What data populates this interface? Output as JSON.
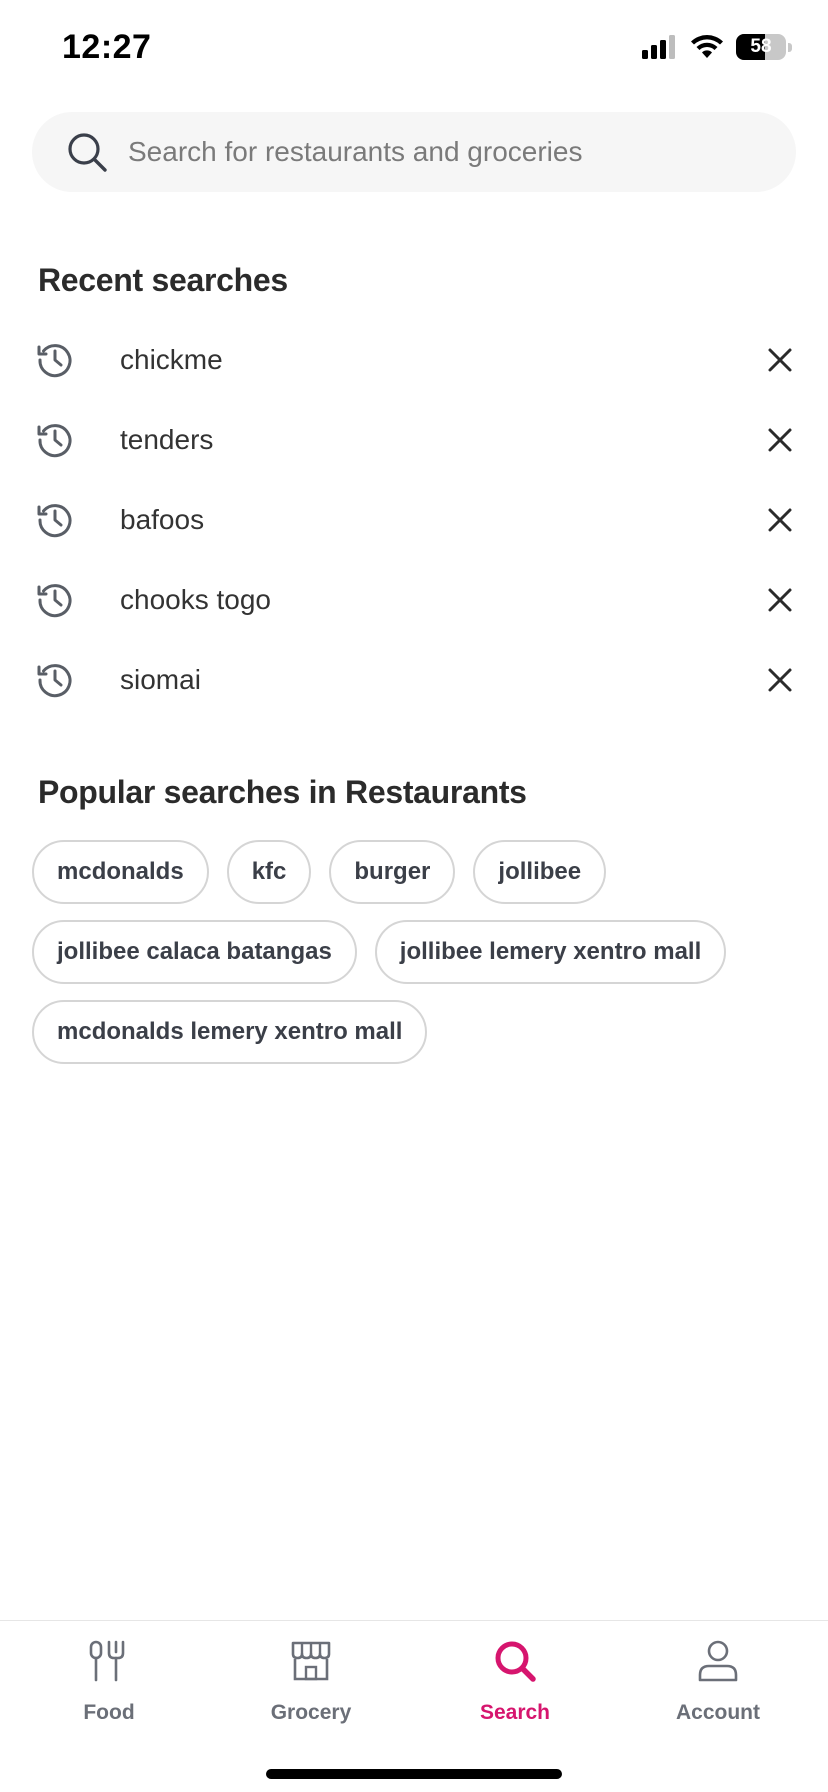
{
  "status_bar": {
    "time": "12:27",
    "battery_level": "58",
    "icons": [
      "signal-icon",
      "wifi-icon",
      "battery-icon"
    ]
  },
  "search": {
    "placeholder": "Search for restaurants and groceries",
    "value": "",
    "icon": "search-icon"
  },
  "recent": {
    "title": "Recent searches",
    "items": [
      {
        "label": "chickme"
      },
      {
        "label": "tenders"
      },
      {
        "label": "bafoos"
      },
      {
        "label": "chooks togo"
      },
      {
        "label": "siomai"
      }
    ]
  },
  "popular": {
    "title": "Popular searches in Restaurants",
    "chips": [
      "mcdonalds",
      "kfc",
      "burger",
      "jollibee",
      "jollibee calaca batangas",
      "jollibee lemery xentro mall",
      "mcdonalds lemery xentro mall"
    ]
  },
  "nav": {
    "items": [
      {
        "label": "Food",
        "icon": "fork-knife-icon",
        "active": false
      },
      {
        "label": "Grocery",
        "icon": "store-icon",
        "active": false
      },
      {
        "label": "Search",
        "icon": "search-icon",
        "active": true
      },
      {
        "label": "Account",
        "icon": "person-icon",
        "active": false
      }
    ]
  },
  "colors": {
    "accent": "#d6156e",
    "text": "#2b2b2b",
    "muted": "#6b6f78",
    "search_bg": "#f6f6f6",
    "chip_border": "#d5d5d5"
  }
}
